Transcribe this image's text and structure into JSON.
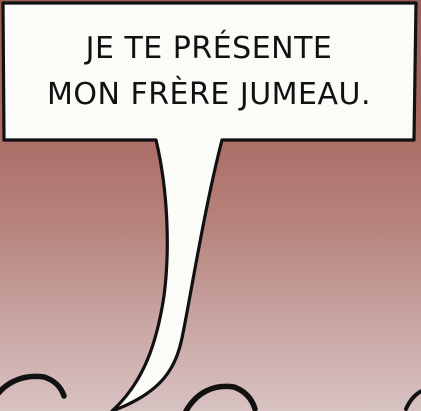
{
  "speech_bubble": {
    "lines": [
      "JE TE PRÉSENTE",
      "MON FRÈRE JUMEAU."
    ]
  },
  "colors": {
    "background_top": "#9a5d55",
    "background_bottom": "#d8c2c2",
    "bubble_fill": "#fbfbf8",
    "ink": "#111111"
  }
}
